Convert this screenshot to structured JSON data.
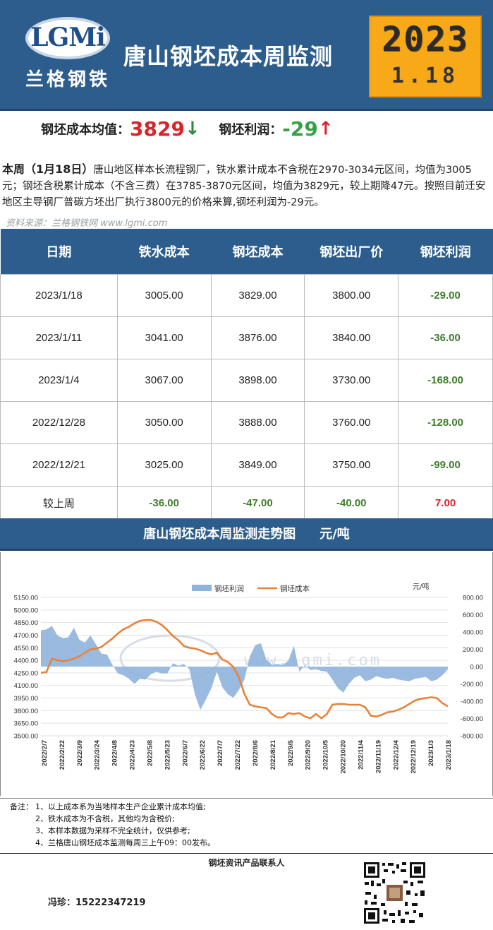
{
  "header": {
    "logo_text": "LGMi",
    "logo_cn": "兰格钢铁",
    "title": "唐山钢坯成本周监测",
    "year": "2023",
    "month_day": "1.18"
  },
  "summary": {
    "avg_label": "钢坯成本均值：",
    "avg_value": "3829",
    "avg_arrow": "↓",
    "profit_label": "钢坯利润：",
    "profit_value": "-29",
    "profit_arrow": "↑"
  },
  "description": {
    "lead": "本周（1月18日）",
    "text": "唐山地区样本长流程钢厂，铁水累计成本不含税在2970-3034元区间，均值为3005元；钢坯含税累计成本（不含三费）在3785-3870元区间，均值为3829元，较上期降47元。按照目前迁安地区主导钢厂普碳方坯出厂执行3800元的价格来算,钢坯利润为-29元。",
    "source": "资料来源：兰格钢铁网 www.lgmi.com"
  },
  "table": {
    "headers": [
      "日期",
      "铁水成本",
      "钢坯成本",
      "钢坯出厂价",
      "钢坯利润"
    ],
    "rows": [
      [
        "2023/1/18",
        "3005.00",
        "3829.00",
        "3800.00",
        "-29.00"
      ],
      [
        "2023/1/11",
        "3041.00",
        "3876.00",
        "3840.00",
        "-36.00"
      ],
      [
        "2023/1/4",
        "3067.00",
        "3898.00",
        "3730.00",
        "-168.00"
      ],
      [
        "2022/12/28",
        "3050.00",
        "3888.00",
        "3760.00",
        "-128.00"
      ],
      [
        "2022/12/21",
        "3025.00",
        "3849.00",
        "3750.00",
        "-99.00"
      ]
    ],
    "compare_row": [
      "较上周",
      "-36.00",
      "-47.00",
      "-40.00",
      "7.00"
    ]
  },
  "chart_title": "唐山钢坯成本周监测走势图",
  "chart_unit": "元/吨",
  "chart_data": {
    "type": "line",
    "watermark": "www.lgmi.com",
    "right_unit": "元/吨",
    "x_ticks": [
      "2022/2/7",
      "2022/2/22",
      "2022/3/9",
      "2022/3/24",
      "2022/4/8",
      "2022/4/23",
      "2022/5/8",
      "2022/5/23",
      "2022/6/7",
      "2022/6/22",
      "2022/7/7",
      "2022/7/22",
      "2022/8/6",
      "2022/8/21",
      "2022/9/5",
      "2022/9/20",
      "2022/10/5",
      "2022/10/20",
      "2022/11/4",
      "2022/11/19",
      "2022/12/4",
      "2022/12/19",
      "2023/1/3",
      "2023/1/18"
    ],
    "y_left": {
      "ticks": [
        "5150.00",
        "5000.00",
        "4850.00",
        "4700.00",
        "4550.00",
        "4400.00",
        "4250.00",
        "4100.00",
        "3950.00",
        "3800.00",
        "3650.00",
        "3500.00"
      ],
      "range": [
        3500,
        5150
      ]
    },
    "y_right": {
      "ticks": [
        "800.00",
        "600.00",
        "400.00",
        "200.00",
        "0.00",
        "-200.00",
        "-400.00",
        "-600.00",
        "-800.00"
      ],
      "range": [
        -800,
        800
      ]
    },
    "series": [
      {
        "name": "钢坯利润",
        "kind": "area",
        "color": "#8fb4dc",
        "values": [
          420,
          430,
          470,
          360,
          330,
          340,
          450,
          310,
          280,
          360,
          260,
          150,
          140,
          20,
          -80,
          -100,
          -140,
          -200,
          -140,
          -150,
          -90,
          -60,
          -80,
          -80,
          40,
          10,
          30,
          -30,
          -320,
          -500,
          -380,
          -250,
          -60,
          -240,
          -320,
          -360,
          -270,
          -150,
          120,
          250,
          270,
          80,
          20,
          30,
          20,
          70,
          240,
          -60,
          20,
          -40,
          -30,
          -50,
          -60,
          -150,
          -250,
          -300,
          -200,
          -130,
          -100,
          -170,
          -150,
          -110,
          -130,
          -140,
          -130,
          -150,
          -160,
          -170,
          -140,
          -130,
          -120,
          -170,
          -150,
          -100,
          -30
        ]
      },
      {
        "name": "钢坯成本",
        "kind": "line",
        "color": "#e8823a",
        "values": [
          4250,
          4260,
          4420,
          4400,
          4390,
          4400,
          4420,
          4450,
          4490,
          4530,
          4540,
          4560,
          4610,
          4660,
          4720,
          4770,
          4800,
          4840,
          4870,
          4880,
          4880,
          4860,
          4820,
          4760,
          4690,
          4640,
          4570,
          4550,
          4540,
          4520,
          4490,
          4470,
          4490,
          4410,
          4380,
          4320,
          4200,
          4000,
          3870,
          3850,
          3840,
          3830,
          3760,
          3720,
          3720,
          3770,
          3760,
          3770,
          3730,
          3710,
          3760,
          3710,
          3760,
          3870,
          3880,
          3880,
          3870,
          3870,
          3870,
          3840,
          3740,
          3730,
          3750,
          3780,
          3790,
          3810,
          3840,
          3880,
          3920,
          3940,
          3950,
          3960,
          3950,
          3890,
          3850
        ]
      }
    ]
  },
  "notes": {
    "label": "备注：",
    "items": [
      "1、以上成本系为当地样本生产企业累计成本均值;",
      "2、铁水成本为不含税，其他均为含税价;",
      "3、本样本数据为采样不完全统计，仅供参考;",
      "4、兰格唐山钢坯成本监测每周三上午09：00发布。"
    ]
  },
  "contact": {
    "title": "钢坯资讯产品联系人",
    "person": "冯珍：15222347219"
  }
}
